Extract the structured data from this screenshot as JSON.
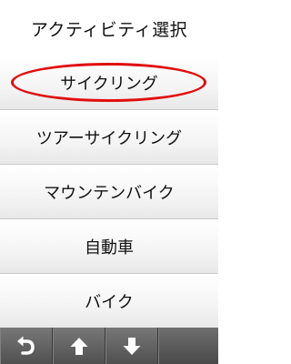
{
  "header": {
    "title": "アクティビティ選択"
  },
  "activities": [
    {
      "label": "サイクリング",
      "highlighted": true
    },
    {
      "label": "ツアーサイクリング",
      "highlighted": false
    },
    {
      "label": "マウンテンバイク",
      "highlighted": false
    },
    {
      "label": "自動車",
      "highlighted": false
    },
    {
      "label": "バイク",
      "highlighted": false
    }
  ],
  "toolbar": {
    "buttons": [
      {
        "icon": "back-icon"
      },
      {
        "icon": "arrow-up-icon"
      },
      {
        "icon": "arrow-down-icon"
      }
    ]
  },
  "colors": {
    "highlight_ring": "#e10d0d",
    "toolbar": "#5a5a5a"
  }
}
